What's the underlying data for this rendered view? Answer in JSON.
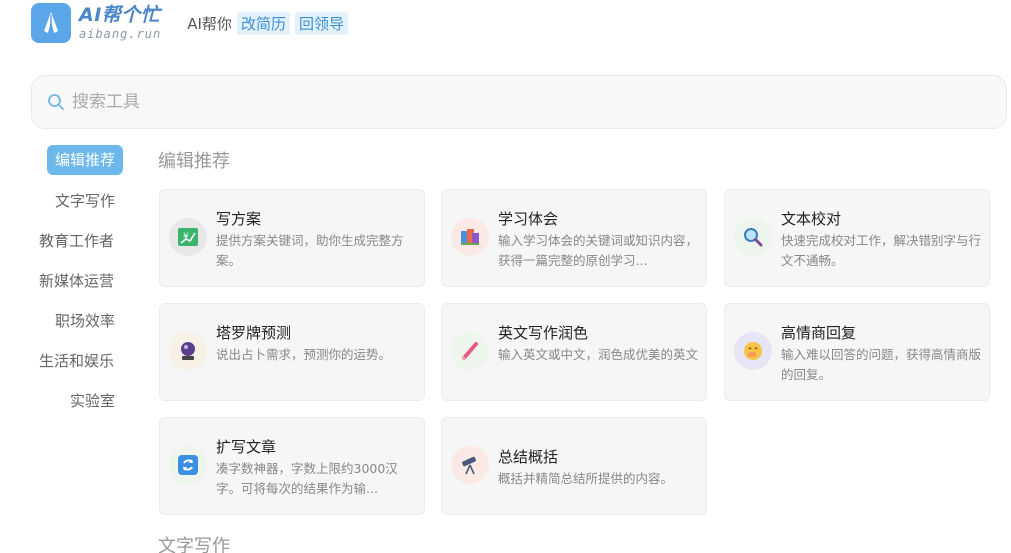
{
  "header": {
    "logo_title": "AI帮个忙",
    "logo_sub": "aibang.run",
    "slogan": "AI帮你",
    "tags": [
      "改简历",
      "回领导"
    ]
  },
  "search": {
    "placeholder": "搜索工具"
  },
  "sidebar": {
    "items": [
      {
        "label": "编辑推荐",
        "active": true
      },
      {
        "label": "文字写作",
        "active": false
      },
      {
        "label": "教育工作者",
        "active": false
      },
      {
        "label": "新媒体运营",
        "active": false
      },
      {
        "label": "职场效率",
        "active": false
      },
      {
        "label": "生活和娱乐",
        "active": false
      },
      {
        "label": "实验室",
        "active": false
      }
    ]
  },
  "sections": [
    {
      "title": "编辑推荐",
      "cards": [
        {
          "title": "写方案",
          "desc": "提供方案关键词，助你生成完整方案。",
          "icon": "money-chart-icon",
          "icon_bg": "#e8e8e8"
        },
        {
          "title": "学习体会",
          "desc": "输入学习体会的关键词或知识内容，获得一篇完整的原创学习...",
          "icon": "books-icon",
          "icon_bg": "#fbe9e5"
        },
        {
          "title": "文本校对",
          "desc": "快速完成校对工作，解决错别字与行文不通畅。",
          "icon": "magnifier-icon",
          "icon_bg": "#eef5ec"
        },
        {
          "title": "塔罗牌预测",
          "desc": "说出占卜需求，预测你的运势。",
          "icon": "crystal-ball-icon",
          "icon_bg": "#f7f1e6"
        },
        {
          "title": "英文写作润色",
          "desc": "输入英文或中文，润色成优美的英文",
          "icon": "pen-icon",
          "icon_bg": "#eef5ec"
        },
        {
          "title": "高情商回复",
          "desc": "输入难以回答的问题，获得高情商版的回复。",
          "icon": "smile-icon",
          "icon_bg": "#e6e4f5"
        },
        {
          "title": "扩写文章",
          "desc": "凑字数神器，字数上限约3000汉字。可将每次的结果作为输...",
          "icon": "refresh-icon",
          "icon_bg": "#eef5ec"
        },
        {
          "title": "总结概括",
          "desc": "概括并精简总结所提供的内容。",
          "icon": "telescope-icon",
          "icon_bg": "#fbe9e5"
        }
      ]
    },
    {
      "title": "文字写作"
    }
  ]
}
